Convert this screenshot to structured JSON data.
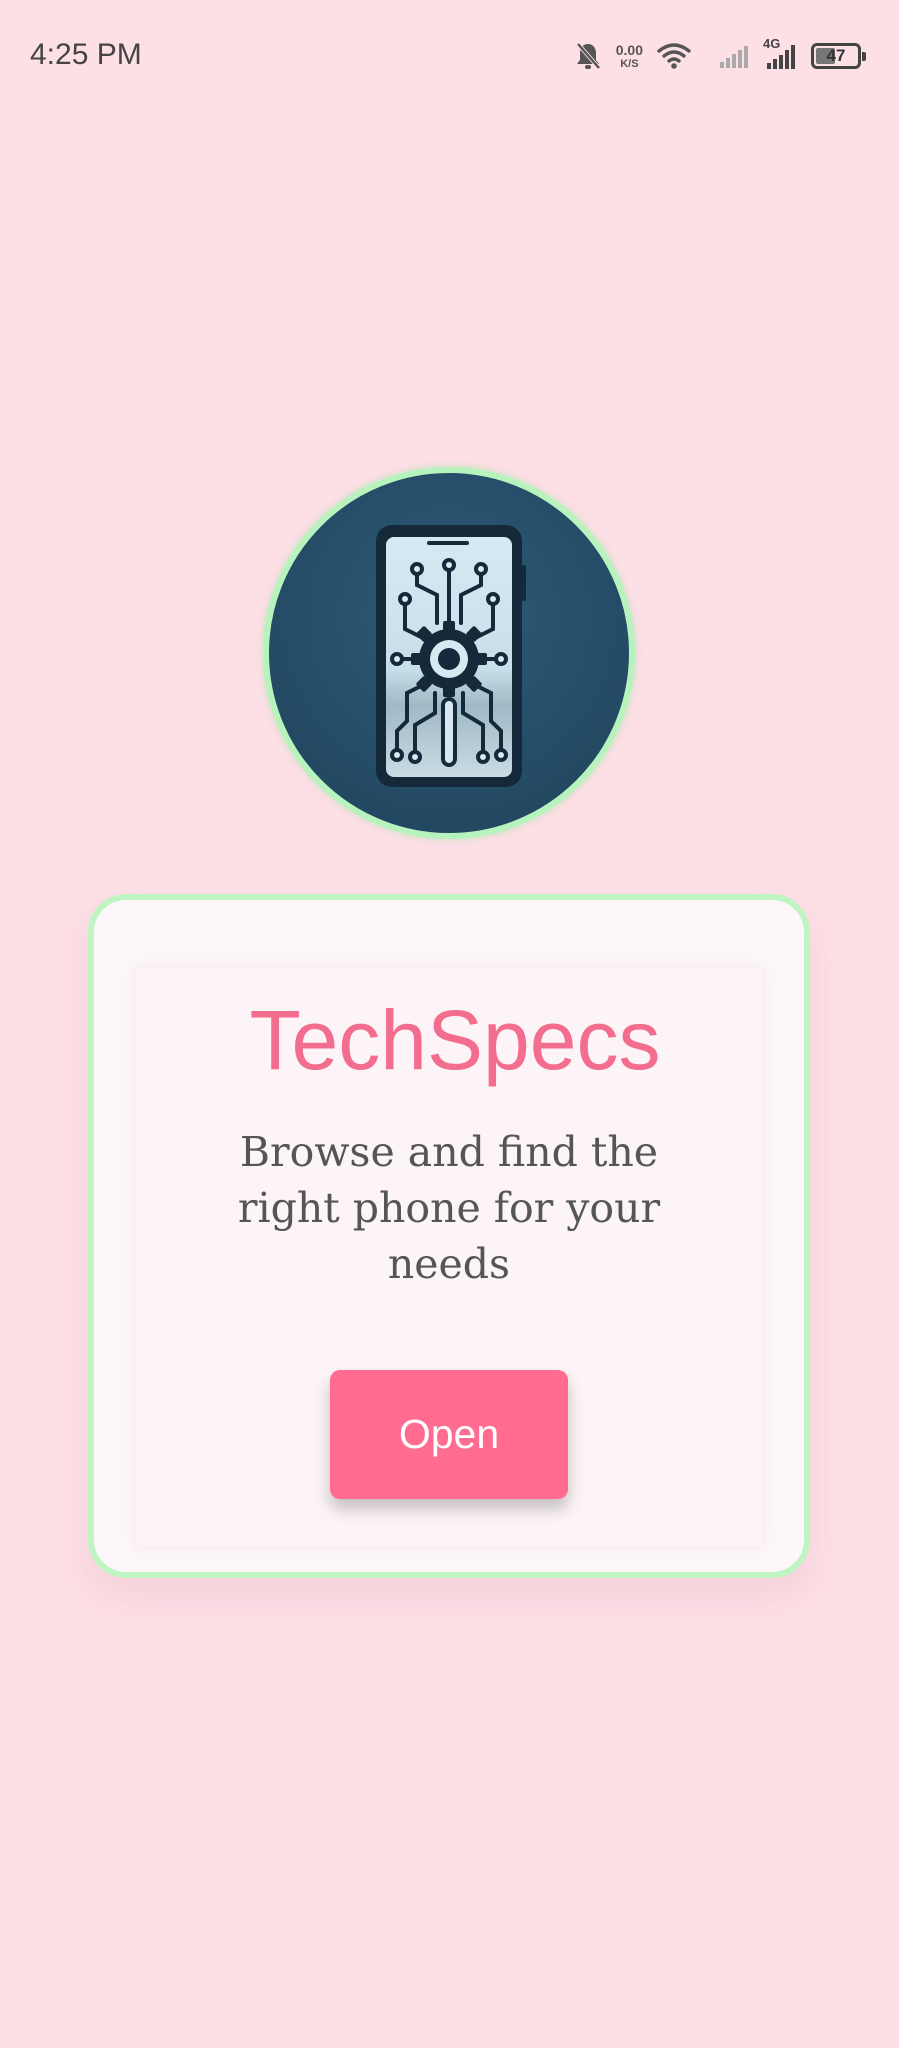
{
  "status_bar": {
    "time": "4:25 PM",
    "net_speed_value": "0.00",
    "net_speed_unit": "K/S",
    "network_type": "4G",
    "battery_level": "47",
    "icons": [
      "notifications-off-icon",
      "wifi-icon",
      "signal-weak-icon",
      "signal-4g-icon",
      "battery-icon"
    ]
  },
  "logo": {
    "icon": "phone-circuit-icon"
  },
  "card": {
    "title": "TechSpecs",
    "description": "Browse and find the right phone for your needs",
    "open_label": "Open"
  },
  "colors": {
    "background": "#fddfe6",
    "accent": "#ff6c8f",
    "title": "#f36d8e",
    "border": "#bff5c3",
    "logo_bg": "#264d68"
  }
}
